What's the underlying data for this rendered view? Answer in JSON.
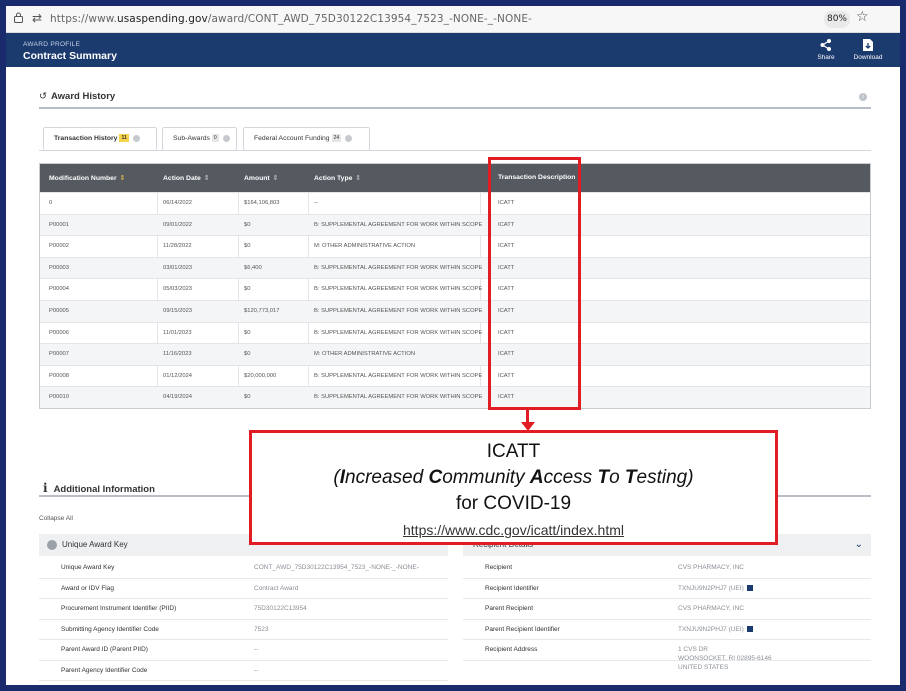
{
  "browser": {
    "url_prefix": "https://www.",
    "url_domain": "usaspending.gov",
    "url_path": "/award/CONT_AWD_75D30122C13954_7523_-NONE-_-NONE-",
    "zoom": "80%"
  },
  "header": {
    "eyebrow": "AWARD PROFILE",
    "title": "Contract Summary",
    "share_label": "Share",
    "download_label": "Download",
    "bg_color": "#1b3a6d"
  },
  "award_history": {
    "heading": "Award History",
    "tabs": [
      {
        "label": "Transaction History",
        "count": "11"
      },
      {
        "label": "Sub-Awards",
        "count": "0"
      },
      {
        "label": "Federal Account Funding",
        "count": "24"
      }
    ],
    "columns": [
      "Modification Number",
      "Action Date",
      "Amount",
      "Action Type",
      "Transaction Description"
    ],
    "rows": [
      [
        "0",
        "06/14/2022",
        "$164,106,803",
        "--",
        "ICATT"
      ],
      [
        "P00001",
        "09/01/2022",
        "$0",
        "B: SUPPLEMENTAL AGREEMENT FOR WORK WITHIN SCOPE",
        "ICATT"
      ],
      [
        "P00002",
        "11/28/2022",
        "$0",
        "M: OTHER ADMINISTRATIVE ACTION",
        "ICATT"
      ],
      [
        "P00003",
        "03/01/2023",
        "$6,400",
        "B: SUPPLEMENTAL AGREEMENT FOR WORK WITHIN SCOPE",
        "ICATT"
      ],
      [
        "P00004",
        "05/03/2023",
        "$0",
        "B: SUPPLEMENTAL AGREEMENT FOR WORK WITHIN SCOPE",
        "ICATT"
      ],
      [
        "P00005",
        "09/15/2023",
        "$120,773,017",
        "B: SUPPLEMENTAL AGREEMENT FOR WORK WITHIN SCOPE",
        "ICATT"
      ],
      [
        "P00006",
        "11/01/2023",
        "$0",
        "B: SUPPLEMENTAL AGREEMENT FOR WORK WITHIN SCOPE",
        "ICATT"
      ],
      [
        "P00007",
        "11/16/2023",
        "$0",
        "M: OTHER ADMINISTRATIVE ACTION",
        "ICATT"
      ],
      [
        "P00008",
        "01/12/2024",
        "$20,000,000",
        "B: SUPPLEMENTAL AGREEMENT FOR WORK WITHIN SCOPE",
        "ICATT"
      ],
      [
        "P00010",
        "04/19/2024",
        "$0",
        "B: SUPPLEMENTAL AGREEMENT FOR WORK WITHIN SCOPE",
        "ICATT"
      ]
    ]
  },
  "additional_info": {
    "heading": "Additional Information",
    "collapse_all": "Collapse All",
    "left_panel": {
      "title": "Unique Award Key",
      "rows": [
        {
          "label": "Unique Award Key",
          "value": "CONT_AWD_75D30122C13954_7523_-NONE-_-NONE-"
        },
        {
          "label": "Award or IDV Flag",
          "value": "Contract Award"
        },
        {
          "label": "Procurement Instrument Identifier (PIID)",
          "value": "75D30122C13954"
        },
        {
          "label": "Submitting Agency Identifier Code",
          "value": "7523"
        },
        {
          "label": "Parent Award ID (Parent PIID)",
          "value": "--"
        },
        {
          "label": "Parent Agency Identifier Code",
          "value": "--"
        }
      ]
    },
    "right_panel": {
      "title": "Recipient Details",
      "rows": [
        {
          "label": "Recipient",
          "value": "CVS PHARMACY, INC"
        },
        {
          "label": "Recipient Identifier",
          "value": "TXNJU9N2PHJ7 (UEI)"
        },
        {
          "label": "Parent Recipient",
          "value": "CVS PHARMACY, INC"
        },
        {
          "label": "Parent Recipient Identifier",
          "value": "TXNJU9N2PHJ7 (UEI)"
        },
        {
          "label": "Recipient Address",
          "value": "1 CVS DR",
          "value2": "WOONSOCKET, RI 02895-6146",
          "value3": "UNITED STATES"
        }
      ]
    }
  },
  "callout": {
    "line1": "ICATT",
    "open_paren": "(",
    "w1_initial": "I",
    "w1_rest": "ncreased ",
    "w2_initial": "C",
    "w2_rest": "ommunity ",
    "w3_initial": "A",
    "w3_rest": "ccess ",
    "w4_initial": "T",
    "w4_rest": "o ",
    "w5_initial": "T",
    "w5_rest": "esting",
    "close_paren": ")",
    "line3": "for COVID-19",
    "link": "https://www.cdc.gov/icatt/index.html",
    "border_color": "#e11c24"
  }
}
